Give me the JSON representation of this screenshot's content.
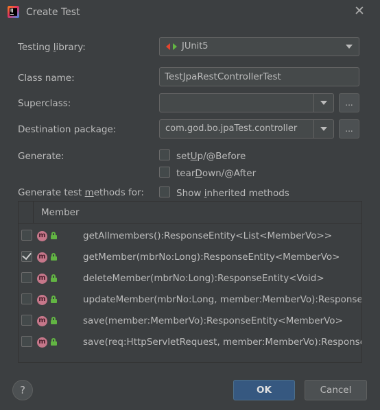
{
  "dialog": {
    "title": "Create Test",
    "close_glyph": "✕"
  },
  "form": {
    "testing_library_label_pre": "Testing ",
    "testing_library_label_u": "l",
    "testing_library_label_post": "ibrary:",
    "testing_library_value": "JUnit5",
    "class_name_label": "Class name:",
    "class_name_value": "TestJpaRestControllerTest",
    "superclass_label": "Superclass:",
    "superclass_value": "",
    "destination_label": "Destination package:",
    "destination_value": "com.god.bo.jpaTest.controller",
    "browse_label": "...",
    "generate_label": "Generate:",
    "setup_pre": "set",
    "setup_u": "U",
    "setup_post": "p/@Before",
    "setup_checked": false,
    "teardown_pre": "tear",
    "teardown_u": "D",
    "teardown_post": "own/@After",
    "teardown_checked": false,
    "methods_label_pre": "Generate test ",
    "methods_label_u": "m",
    "methods_label_post": "ethods for:",
    "show_inherited_pre": "Show ",
    "show_inherited_u": "i",
    "show_inherited_post": "nherited methods",
    "show_inherited_checked": false
  },
  "members_table": {
    "header": "Member",
    "rows": [
      {
        "checked": false,
        "signature": "getAllmembers():ResponseEntity<List<MemberVo>>"
      },
      {
        "checked": true,
        "signature": "getMember(mbrNo:Long):ResponseEntity<MemberVo>"
      },
      {
        "checked": false,
        "signature": "deleteMember(mbrNo:Long):ResponseEntity<Void>"
      },
      {
        "checked": false,
        "signature": "updateMember(mbrNo:Long, member:MemberVo):ResponseEntity<MemberVo>"
      },
      {
        "checked": false,
        "signature": "save(member:MemberVo):ResponseEntity<MemberVo>"
      },
      {
        "checked": false,
        "signature": "save(req:HttpServletRequest, member:MemberVo):ResponseEntity<MemberVo>"
      }
    ],
    "method_icon_letter": "m"
  },
  "footer": {
    "help_label": "?",
    "ok_label": "OK",
    "cancel_label": "Cancel"
  },
  "colors": {
    "background": "#3c3f41",
    "accent_button": "#365880",
    "method_icon": "#c6778a",
    "lock_icon": "#62b543"
  }
}
